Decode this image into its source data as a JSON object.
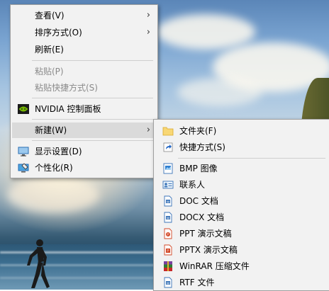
{
  "context_menu": {
    "items": [
      {
        "label": "查看(V)"
      },
      {
        "label": "排序方式(O)"
      },
      {
        "label": "刷新(E)"
      },
      {
        "label": "粘贴(P)"
      },
      {
        "label": "粘贴快捷方式(S)"
      },
      {
        "label": "NVIDIA 控制面板",
        "icon": "nvidia-icon"
      },
      {
        "label": "新建(W)"
      },
      {
        "label": "显示设置(D)",
        "icon": "display-icon"
      },
      {
        "label": "个性化(R)",
        "icon": "personalize-icon"
      }
    ],
    "submenu_arrow": "›"
  },
  "new_submenu": {
    "items": [
      {
        "label": "文件夹(F)",
        "icon": "folder-icon"
      },
      {
        "label": "快捷方式(S)",
        "icon": "shortcut-icon"
      },
      {
        "label": "BMP 图像",
        "icon": "bmp-image-icon"
      },
      {
        "label": "联系人",
        "icon": "contact-icon"
      },
      {
        "label": "DOC 文档",
        "icon": "doc-icon"
      },
      {
        "label": "DOCX 文档",
        "icon": "docx-icon"
      },
      {
        "label": "PPT 演示文稿",
        "icon": "ppt-icon"
      },
      {
        "label": "PPTX 演示文稿",
        "icon": "pptx-icon"
      },
      {
        "label": "WinRAR 压缩文件",
        "icon": "winrar-icon"
      },
      {
        "label": "RTF 文件",
        "icon": "rtf-icon"
      }
    ]
  },
  "colors": {
    "menu_bg": "#f2f2f2",
    "hover_bg": "#dadada",
    "disabled_text": "#8a8a8a",
    "nvidia_green": "#76b900",
    "office_blue": "#3b74b8",
    "office_orange": "#d24726"
  }
}
